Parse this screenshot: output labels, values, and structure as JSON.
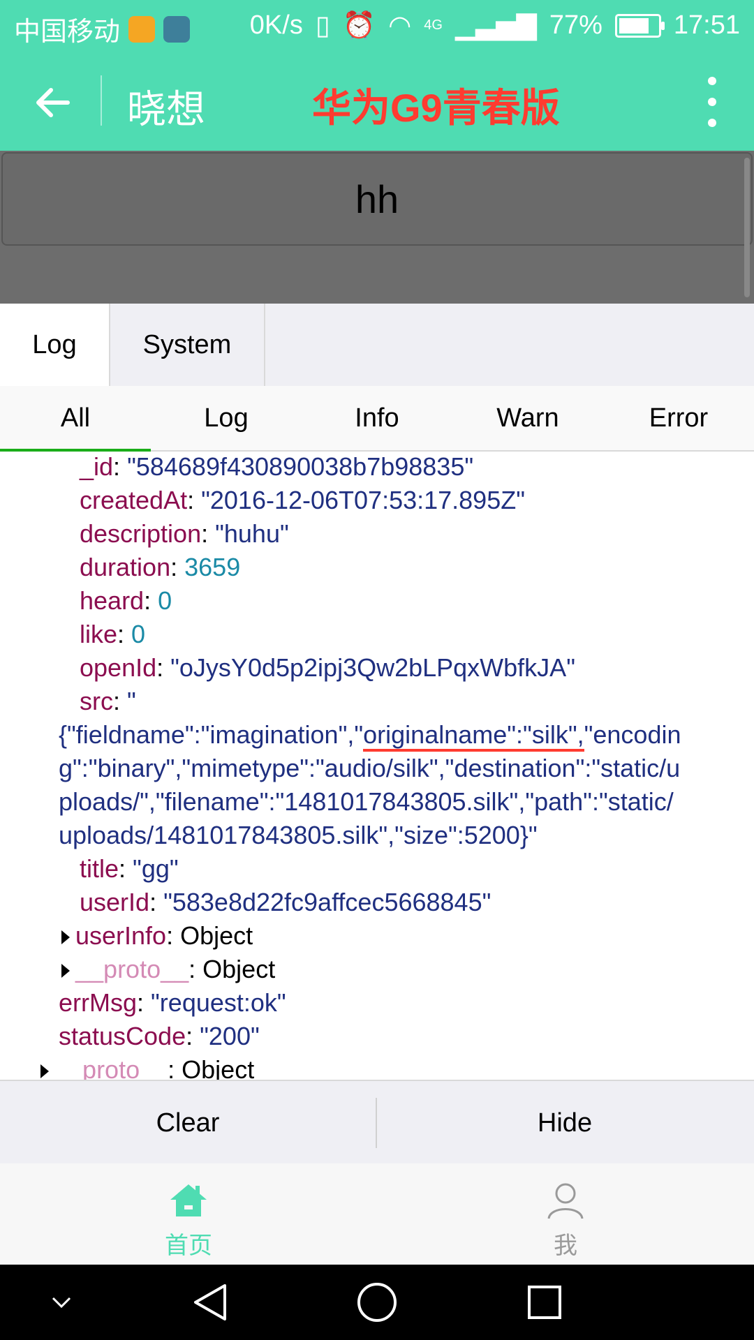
{
  "statusbar": {
    "carrier": "中国移动",
    "speed": "0K/s",
    "network": "4G",
    "battery": "77%",
    "battery_level": 0.77,
    "time": "17:51"
  },
  "appbar": {
    "title": "晓想",
    "device_label": "华为G9青春版"
  },
  "page": {
    "card_text": "hh"
  },
  "console": {
    "tabs": [
      {
        "label": "Log",
        "active": true
      },
      {
        "label": "System",
        "active": false
      }
    ],
    "filters": [
      "All",
      "Log",
      "Info",
      "Warn",
      "Error"
    ],
    "active_filter": "All",
    "entries": {
      "id_key": "_id",
      "id_val": "\"584689f430890038b7b98835\"",
      "created_key": "createdAt",
      "created_val": "\"2016-12-06T07:53:17.895Z\"",
      "desc_key": "description",
      "desc_val": "\"huhu\"",
      "duration_key": "duration",
      "duration_val": "3659",
      "heard_key": "heard",
      "heard_val": "0",
      "like_key": "like",
      "like_val": "0",
      "openid_key": "openId",
      "openid_val": "\"oJysY0d5p2ipj3Qw2bLPqxWbfkJA\"",
      "src_key": "src",
      "src_val_start": "\"",
      "src_line1_a": "{\"fieldname\":\"imagination\",\"",
      "src_line1_b": "originalname\":\"silk\",",
      "src_line1_c": "\"encodin",
      "src_line2": "g\":\"binary\",\"mimetype\":\"audio/silk\",\"destination\":\"static/u",
      "src_line3": "ploads/\",\"filename\":\"1481017843805.silk\",\"path\":\"static/",
      "src_line4": "uploads/1481017843805.silk\",\"size\":5200}\"",
      "title_key": "title",
      "title_val": "\"gg\"",
      "userid_key": "userId",
      "userid_val": "\"583e8d22fc9affcec5668845\"",
      "userinfo_key": "userInfo",
      "userinfo_val": "Object",
      "proto_key": "__proto__",
      "proto_val": "Object",
      "errmsg_key": "errMsg",
      "errmsg_val": "\"request:ok\"",
      "status_key": "statusCode",
      "status_val": "\"200\"",
      "proto2_val": "Object"
    },
    "actions": {
      "clear": "Clear",
      "hide": "Hide"
    }
  },
  "tabbar": {
    "items": [
      {
        "label": "首页",
        "icon": "home-icon",
        "active": true
      },
      {
        "label": "我",
        "icon": "person-icon",
        "active": false
      }
    ]
  },
  "colors": {
    "accent": "#4fdcb2",
    "device_label": "#ff3b30",
    "key": "#8b0d4f",
    "string": "#1f2f80",
    "number": "#1a8aa6"
  }
}
